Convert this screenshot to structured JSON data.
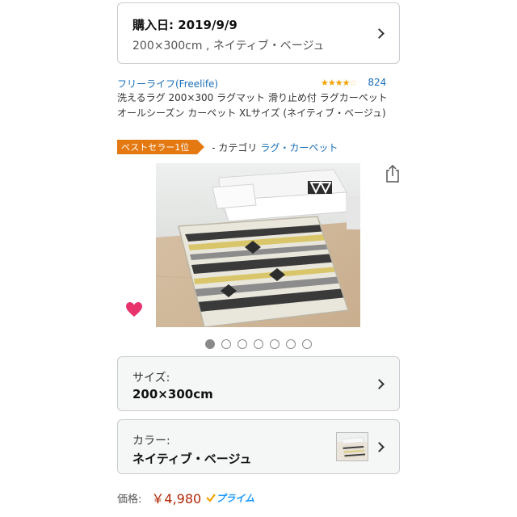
{
  "purchase": {
    "title": "購入日: 2019/9/9",
    "variant": "200×300cm , ネイティブ・ベージュ"
  },
  "product": {
    "brand": "フリーライフ(Freelife)",
    "rating_stars": 4,
    "review_count": "824",
    "title": "洗えるラグ 200×300 ラグマット 滑り止め付 ラグカーペット オールシーズン カーペット XLサイズ (ネイティブ・ベージュ)",
    "bestseller_badge": "ベストセラー1位",
    "category_prefix": "- カテゴリ",
    "category_link": "ラグ・カーペット"
  },
  "gallery": {
    "image_count": 7,
    "active_index": 0
  },
  "options": {
    "size_label": "サイズ:",
    "size_value": "200×300cm",
    "color_label": "カラー:",
    "color_value": "ネイティブ・ベージュ"
  },
  "price": {
    "label": "価格:",
    "value": "￥4,980",
    "prime_label": "プライム"
  },
  "colors": {
    "link": "#1a6fb8",
    "badge": "#e47911",
    "price": "#b12704",
    "star": "#f2a100",
    "heart": "#e8336d",
    "prime": "#1a98ff"
  },
  "icons": {
    "chevron": "chevron-right-icon",
    "share": "share-icon",
    "favorite": "heart-icon",
    "prime_check": "check-icon"
  }
}
